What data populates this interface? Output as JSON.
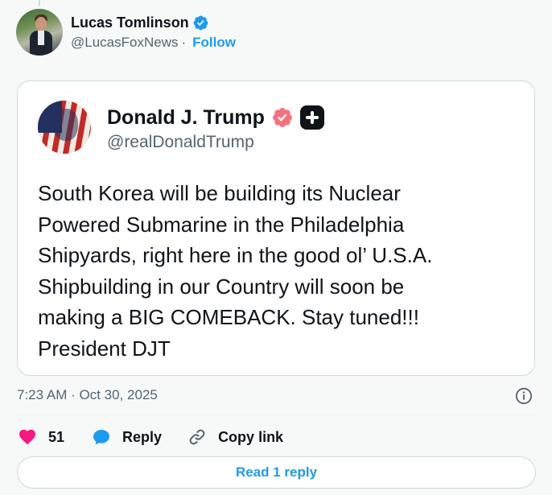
{
  "author": {
    "name": "Lucas Tomlinson",
    "handle": "@LucasFoxNews",
    "separator": "·",
    "follow_label": "Follow"
  },
  "quoted_post": {
    "name": "Donald J. Trump",
    "handle": "@realDonaldTrump",
    "text": "South Korea will be building its Nuclear\nPowered Submarine in the Philadelphia\nShipyards, right here in the good ol’ U.S.A.\nShipbuilding in our Country will soon be\nmaking a BIG COMEBACK. Stay tuned!!!\nPresident DJT"
  },
  "meta": {
    "timestamp": "7:23 AM · Oct 30, 2025"
  },
  "actions": {
    "like_count": "51",
    "reply_label": "Reply",
    "copy_link_label": "Copy link"
  },
  "read_replies_label": "Read 1 reply",
  "colors": {
    "accent": "#1d9bf0",
    "like": "#f91880",
    "gold_badge": "#f4727e",
    "muted_text": "#536471",
    "border": "#cfd9de"
  },
  "icons": [
    "verified-badge-icon",
    "info-icon",
    "heart-icon",
    "reply-bubble-icon",
    "link-icon",
    "affiliate-plus-icon"
  ]
}
